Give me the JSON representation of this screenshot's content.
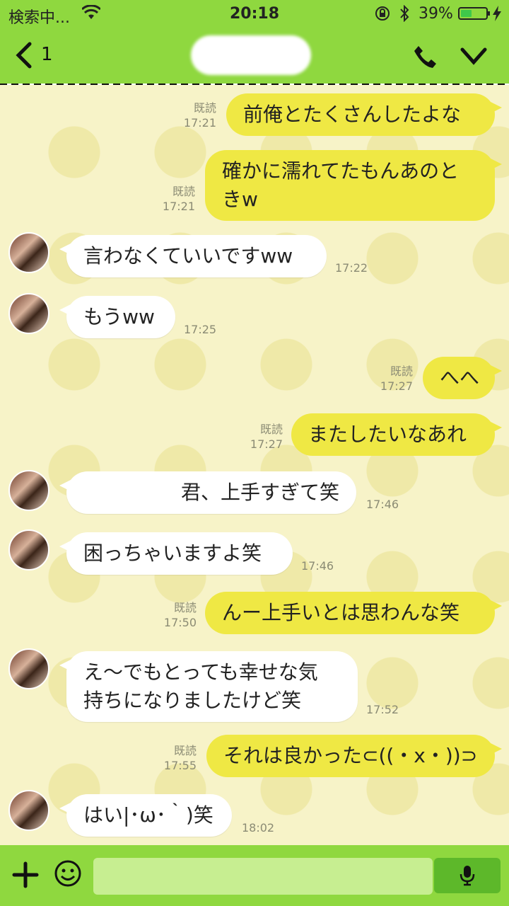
{
  "status": {
    "carrier": "検索中...",
    "time": "20:18",
    "battery": "39%",
    "battery_level": 0.39
  },
  "header": {
    "back_count": "1",
    "title": ""
  },
  "messages": [
    {
      "side": "mine",
      "text": "前俺とたくさんしたよな",
      "read": "既読",
      "time": "17:21"
    },
    {
      "side": "mine",
      "text": "確かに濡れてたもんあのと\nきw",
      "read": "既読",
      "time": "17:21"
    },
    {
      "side": "theirs",
      "text": "言わなくていいですww",
      "time": "17:22"
    },
    {
      "side": "theirs",
      "text": "もうww",
      "time": "17:25"
    },
    {
      "side": "mine",
      "text": "へへ",
      "read": "既読",
      "time": "17:27"
    },
    {
      "side": "mine",
      "text": "またしたいなあれ",
      "read": "既読",
      "time": "17:27"
    },
    {
      "side": "theirs",
      "text": "君、上手すぎて笑",
      "time": "17:46"
    },
    {
      "side": "theirs",
      "text": "困っちゃいますよ笑",
      "time": "17:46"
    },
    {
      "side": "mine",
      "text": "んー上手いとは思わんな笑",
      "read": "既読",
      "time": "17:50"
    },
    {
      "side": "theirs",
      "text": "え〜でもとっても幸せな気\n持ちになりましたけど笑",
      "time": "17:52"
    },
    {
      "side": "mine",
      "text": "それは良かった⊂((・x・))⊃",
      "read": "既読",
      "time": "17:55"
    },
    {
      "side": "theirs",
      "text": "はい|･ω･｀)笑",
      "time": "18:02"
    }
  ],
  "input": {
    "placeholder": ""
  },
  "icons": {
    "back": "chevron-left-icon",
    "call": "phone-icon",
    "menu": "chevron-down-icon",
    "plus": "plus-icon",
    "emoji": "smiley-icon",
    "mic": "microphone-icon"
  },
  "colors": {
    "header": "#8fd83f",
    "mine_bubble": "#efe844",
    "their_bubble": "#ffffff",
    "background": "#f7f3c8"
  }
}
